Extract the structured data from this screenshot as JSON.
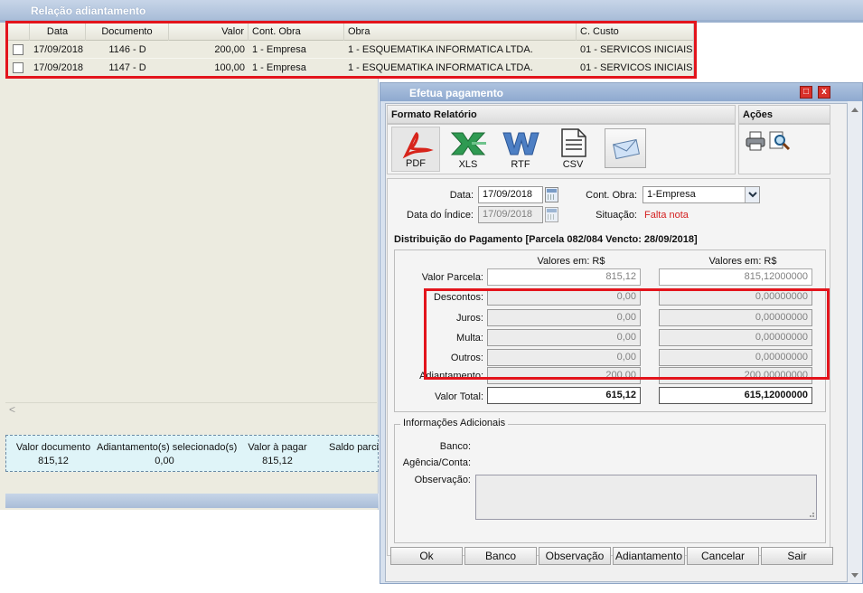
{
  "background": {
    "title": "Relação adiantamento",
    "columns": [
      "Data",
      "Documento",
      "Valor",
      "Cont. Obra",
      "Obra",
      "C. Custo"
    ],
    "rows": [
      {
        "data": "17/09/2018",
        "documento": "1146 - D",
        "valor": "200,00",
        "cont_obra": "1 - Empresa",
        "obra": "1 - ESQUEMATIKA INFORMATICA LTDA.",
        "c_custo": "01 - SERVICOS INICIAIS"
      },
      {
        "data": "17/09/2018",
        "documento": "1147 - D",
        "valor": "100,00",
        "cont_obra": "1 - Empresa",
        "obra": "1 - ESQUEMATIKA INFORMATICA LTDA.",
        "c_custo": "01 - SERVICOS INICIAIS"
      }
    ],
    "summary": {
      "valor_documento_label": "Valor documento",
      "valor_documento": "815,12",
      "adiantamentos_label": "Adiantamento(s) selecionado(s)",
      "adiantamentos": "0,00",
      "valor_pagar_label": "Valor à pagar",
      "valor_pagar": "815,12",
      "saldo_label": "Saldo parci"
    },
    "scroll_arrow": "<"
  },
  "dialog": {
    "title": "Efetua pagamento",
    "format_section": "Formato Relatório",
    "actions_section": "Ações",
    "formats": [
      "PDF",
      "XLS",
      "RTF",
      "CSV"
    ],
    "data_label": "Data:",
    "data_value": "17/09/2018",
    "data_indice_label": "Data do Índice:",
    "data_indice_value": "17/09/2018",
    "cont_obra_label": "Cont. Obra:",
    "cont_obra_value": "1-Empresa",
    "situacao_label": "Situação:",
    "situacao_value": "Falta nota",
    "distribuicao_title": "Distribuição do Pagamento [Parcela 082/084 Vencto: 28/09/2018]",
    "valores_header_1": "Valores em: R$",
    "valores_header_2": "Valores em: R$",
    "fields": [
      {
        "label": "Valor Parcela:",
        "v1": "815,12",
        "v2": "815,12000000"
      },
      {
        "label": "Descontos:",
        "v1": "0,00",
        "v2": "0,00000000"
      },
      {
        "label": "Juros:",
        "v1": "0,00",
        "v2": "0,00000000"
      },
      {
        "label": "Multa:",
        "v1": "0,00",
        "v2": "0,00000000"
      },
      {
        "label": "Outros:",
        "v1": "0,00",
        "v2": "0,00000000"
      },
      {
        "label": "Adiantamento:",
        "v1": "200,00",
        "v2": "200,00000000"
      }
    ],
    "total": {
      "label": "Valor Total:",
      "v1": "615,12",
      "v2": "615,12000000"
    },
    "info_title": "Informações Adicionais",
    "banco_label": "Banco:",
    "agencia_label": "Agência/Conta:",
    "observacao_label": "Observação:",
    "observacao_value": "",
    "buttons": [
      "Ok",
      "Banco",
      "Observação",
      "Adiantamento",
      "Cancelar",
      "Sair"
    ]
  },
  "colors": {
    "highlight": "#e3141c",
    "situacao": "#d42020"
  }
}
